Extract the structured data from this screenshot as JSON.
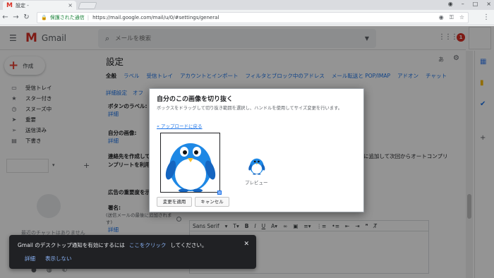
{
  "browser": {
    "tab_title": "設定 -",
    "secure_text": "保護された通信",
    "url": "https://mail.google.com/mail/u/0/#settings/general"
  },
  "gmail": {
    "logo_text": "Gmail",
    "search_placeholder": "メールを検索",
    "notification_count": "1",
    "compose_label": "作成",
    "nav_items": [
      "受信トレイ",
      "スター付き",
      "スヌーズ中",
      "重要",
      "送信済み",
      "下書き"
    ],
    "hangouts_text": "最近のチャットはありません"
  },
  "settings": {
    "title": "設定",
    "lang_icon": "あ",
    "tabs": [
      "全般",
      "ラベル",
      "受信トレイ",
      "アカウントとインポート",
      "フィルタとブロック中のアドレス",
      "メール転送と POP/IMAP",
      "アドオン",
      "チャット"
    ],
    "subtabs": [
      "詳細設定",
      "オフ"
    ],
    "rows": {
      "buttons_label": "ボタンのラベル:",
      "buttons_link": "詳細",
      "my_image_label": "自分の画像:",
      "my_image_link": "詳細",
      "autocomplete_label": "連絡先を作成して",
      "autocomplete_link": "ンプリートを利用",
      "autocomplete_right": "に追加して次回からオートコンプリ",
      "importance_label": "広告の重要度を示",
      "signature_label": "署名:",
      "signature_sub": "(送信メールの最後に追加されま",
      "signature_sub2": "す)",
      "signature_link": "詳細"
    },
    "editor_font": "Sans Serif"
  },
  "dialog": {
    "title": "自分のこの画像を切り抜く",
    "instructions": "ボックスをドラッグして切り抜き範囲を選択し、ハンドルを使用してサイズ変更を行います。",
    "back_link": "« アップロードに戻る",
    "preview_label": "プレビュー",
    "apply_button": "変更を適用",
    "cancel_button": "キャンセル"
  },
  "snackbar": {
    "message_prefix": "Gmail のデスクトップ通知を有効にするには",
    "link": "ここをクリック",
    "message_suffix": "してください。",
    "details": "詳細",
    "dont_show": "表示しない"
  },
  "colors": {
    "accent": "#1a73e8",
    "gmail_red": "#d93025",
    "penguin_blue": "#1e88e5",
    "penguin_beak": "#fbc02d"
  }
}
